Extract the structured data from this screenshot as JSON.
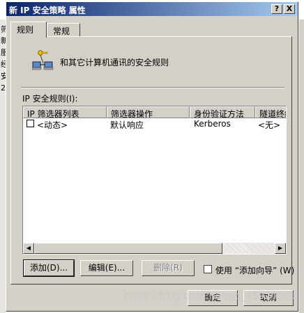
{
  "background_window": {
    "visible_chars": [
      "筛",
      "新",
      "服",
      "经",
      "安",
      "2"
    ]
  },
  "dialog": {
    "title": "新 IP 安全策略 属性",
    "help_button": "?",
    "close_button": "X"
  },
  "tabs": [
    {
      "label": "规则",
      "active": true
    },
    {
      "label": "常规",
      "active": false
    }
  ],
  "rules_tab": {
    "description": "和其它计算机通讯的安全规则",
    "list_label": "IP 安全规则(I):",
    "columns": [
      "IP 筛选器列表",
      "筛选器操作",
      "身份验证方法",
      "隧道终结点"
    ],
    "rows": [
      {
        "checked": false,
        "filter_list": "<动态>",
        "filter_action": "默认响应",
        "auth_method": "Kerberos",
        "tunnel": "<无>"
      }
    ],
    "buttons": {
      "add": "添加(D)...",
      "edit": "编辑(E)...",
      "remove": "删除(R)"
    },
    "use_wizard": {
      "checked": false,
      "label": "使用 “添加向导” (W)"
    }
  },
  "footer": {
    "ok": "确定",
    "cancel": "取消"
  },
  "watermark": "https://blog.csdn.net/qq_45924001",
  "colors": {
    "title_bar_start": "#0a246a",
    "title_bar_end": "#a6caf0",
    "face": "#d4d0c8"
  }
}
